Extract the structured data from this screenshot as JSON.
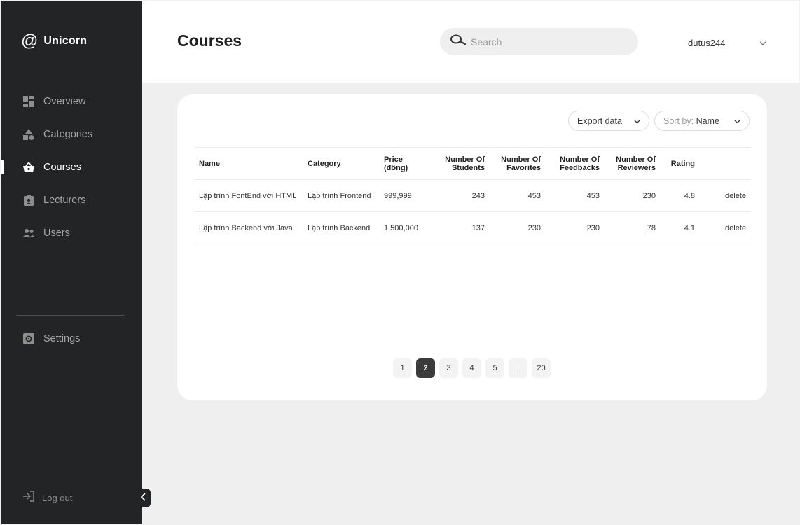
{
  "brand": {
    "name": "Unicorn",
    "at_symbol": "@"
  },
  "nav": {
    "items": [
      {
        "label": "Overview",
        "icon": "dashboard-icon"
      },
      {
        "label": "Categories",
        "icon": "shapes-icon"
      },
      {
        "label": "Courses",
        "icon": "basket-icon",
        "active": true
      },
      {
        "label": "Lecturers",
        "icon": "badge-icon"
      },
      {
        "label": "Users",
        "icon": "users-icon"
      }
    ],
    "settings_label": "Settings",
    "logout_label": "Log out"
  },
  "header": {
    "title": "Courses",
    "search_placeholder": "Search",
    "username": "dutus244"
  },
  "toolbar": {
    "export_label": "Export data",
    "sort_prefix": "Sort by:",
    "sort_value": "Name"
  },
  "table": {
    "headers": [
      "Name",
      "Category",
      "Price (đồng)",
      "Number Of Students",
      "Number Of Favorites",
      "Number Of Feedbacks",
      "Number Of Reviewers",
      "Rating",
      ""
    ],
    "rows": [
      {
        "name": "Lập trình FontEnd với HTML",
        "category": "Lập trình Frontend",
        "price": "999,999",
        "students": "243",
        "favorites": "453",
        "feedbacks": "453",
        "reviewers": "230",
        "rating": "4.8",
        "action": "delete"
      },
      {
        "name": "Lập trình Backend với Java",
        "category": "Lập trình Backend",
        "price": "1,500,000",
        "students": "137",
        "favorites": "230",
        "feedbacks": "230",
        "reviewers": "78",
        "rating": "4.1",
        "action": "delete"
      }
    ]
  },
  "pagination": {
    "pages": [
      "1",
      "2",
      "3",
      "4",
      "5",
      "...",
      "20"
    ],
    "current": "2"
  },
  "colors": {
    "sidebar": "#232425",
    "background": "#efefef",
    "active_page": "#3b3b3b"
  }
}
